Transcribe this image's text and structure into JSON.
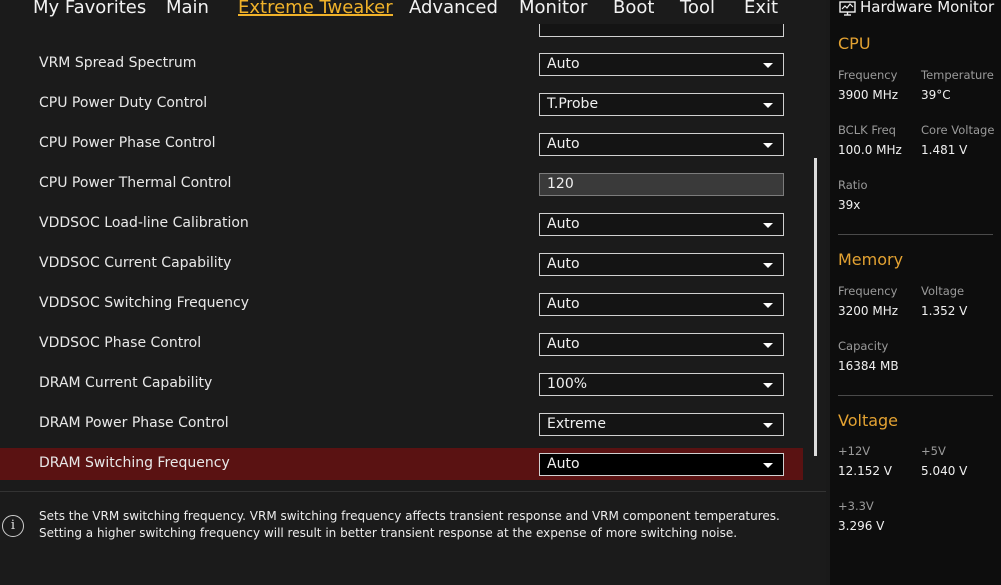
{
  "menu": {
    "tabs": [
      "My Favorites",
      "Main",
      "Extreme Tweaker",
      "Advanced",
      "Monitor",
      "Boot",
      "Tool",
      "Exit"
    ],
    "active": "Extreme Tweaker"
  },
  "settings": {
    "rows": [
      {
        "label": "VRM Spread Spectrum",
        "value": "Auto",
        "type": "dropdown"
      },
      {
        "label": "CPU Power Duty Control",
        "value": "T.Probe",
        "type": "dropdown"
      },
      {
        "label": "CPU Power Phase Control",
        "value": "Auto",
        "type": "dropdown"
      },
      {
        "label": "CPU Power Thermal Control",
        "value": "120",
        "type": "input"
      },
      {
        "label": "VDDSOC Load-line Calibration",
        "value": "Auto",
        "type": "dropdown"
      },
      {
        "label": "VDDSOC Current Capability",
        "value": "Auto",
        "type": "dropdown"
      },
      {
        "label": "VDDSOC Switching Frequency",
        "value": "Auto",
        "type": "dropdown"
      },
      {
        "label": "VDDSOC Phase Control",
        "value": "Auto",
        "type": "dropdown"
      },
      {
        "label": "DRAM Current Capability",
        "value": "100%",
        "type": "dropdown"
      },
      {
        "label": "DRAM Power Phase Control",
        "value": "Extreme",
        "type": "dropdown"
      },
      {
        "label": "DRAM Switching Frequency",
        "value": "Auto",
        "type": "dropdown",
        "selected": true
      }
    ]
  },
  "help": {
    "text": "Sets the VRM switching frequency.  VRM switching frequency affects transient response and VRM component temperatures. Setting a higher switching frequency will result in better transient response at the expense of more switching noise."
  },
  "hardware_monitor": {
    "title": "Hardware Monitor",
    "accent_color": "#e3a232",
    "cpu": {
      "heading": "CPU",
      "frequency_label": "Frequency",
      "frequency": "3900 MHz",
      "temperature_label": "Temperature",
      "temperature": "39°C",
      "bclk_label": "BCLK Freq",
      "bclk": "100.0 MHz",
      "core_voltage_label": "Core Voltage",
      "core_voltage": "1.481 V",
      "ratio_label": "Ratio",
      "ratio": "39x"
    },
    "memory": {
      "heading": "Memory",
      "frequency_label": "Frequency",
      "frequency": "3200 MHz",
      "voltage_label": "Voltage",
      "voltage": "1.352 V",
      "capacity_label": "Capacity",
      "capacity": "16384 MB"
    },
    "voltage": {
      "heading": "Voltage",
      "v12_label": "+12V",
      "v12": "12.152 V",
      "v5_label": "+5V",
      "v5": "5.040 V",
      "v33_label": "+3.3V",
      "v33": "3.296 V"
    }
  }
}
